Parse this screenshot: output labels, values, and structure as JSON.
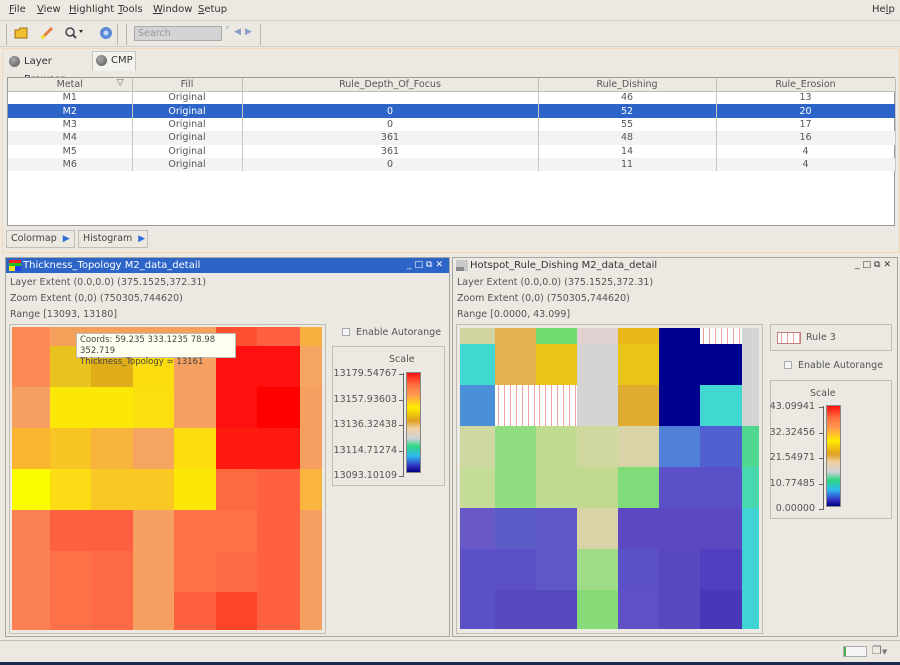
{
  "menu": {
    "items": [
      {
        "label": "File",
        "u": "F",
        "rest": "ile"
      },
      {
        "label": "View",
        "u": "V",
        "rest": "iew"
      },
      {
        "label": "Highlight",
        "u": "H",
        "rest": "ighlight"
      },
      {
        "label": "Tools",
        "u": "T",
        "rest": "ools"
      },
      {
        "label": "Window",
        "u": "W",
        "rest": "indow"
      },
      {
        "label": "Setup",
        "u": "S",
        "rest": "etup"
      }
    ],
    "help": {
      "label": "Help",
      "pre": "He",
      "u": "l",
      "rest": "p"
    }
  },
  "toolbar": {
    "search_placeholder": "Search"
  },
  "tabs": [
    {
      "label": "Layer Browser",
      "active": false
    },
    {
      "label": "CMP",
      "active": true
    }
  ],
  "table": {
    "columns": [
      "Metal",
      "Fill",
      "Rule_Depth_Of_Focus",
      "Rule_Dishing",
      "Rule_Erosion"
    ],
    "rows": [
      {
        "metal": "M1",
        "fill": "Original",
        "dof": "",
        "dishing": "46",
        "erosion": "13"
      },
      {
        "metal": "M2",
        "fill": "Original",
        "dof": "0",
        "dishing": "52",
        "erosion": "20",
        "selected": true
      },
      {
        "metal": "M3",
        "fill": "Original",
        "dof": "0",
        "dishing": "55",
        "erosion": "17"
      },
      {
        "metal": "M4",
        "fill": "Original",
        "dof": "361",
        "dishing": "48",
        "erosion": "16"
      },
      {
        "metal": "M5",
        "fill": "Original",
        "dof": "361",
        "dishing": "14",
        "erosion": "4"
      },
      {
        "metal": "M6",
        "fill": "Original",
        "dof": "0",
        "dishing": "11",
        "erosion": "4"
      }
    ]
  },
  "bottom_buttons": {
    "colormap": "Colormap",
    "histogram": "Histogram"
  },
  "left_view": {
    "title": "Thickness_Topology M2_data_detail",
    "layer_extent": "Layer Extent (0.0,0.0) (375.1525,372.31)",
    "zoom_extent": "Zoom Extent (0,0) (750305,744620)",
    "range": "Range [13093, 13180]",
    "tooltip_line1": "Coords: 59.235 333.1235 78.98 352.719",
    "tooltip_line2": "Thickness_Topology = 13161",
    "autorange_label": "Enable Autorange",
    "scale_title": "Scale",
    "scale_ticks": [
      "13179.54767",
      "13157.93603",
      "13136.32438",
      "13114.71274",
      "13093.10109"
    ],
    "grid": [
      [
        "#fb8a55",
        "#f5a05a",
        "#f5a05a",
        "#f5a05a",
        "#f5a05a",
        "#fd5030",
        "#fe6040",
        "#f9b040"
      ],
      [
        "#fb8a55",
        "#e8c21e",
        "#e0ad1a",
        "#fbdc0f",
        "#f5a060",
        "#fe1010",
        "#fe1010",
        "#f5a560"
      ],
      [
        "#f5a060",
        "#fbe808",
        "#fbe808",
        "#fbe010",
        "#f5a060",
        "#fe1010",
        "#fe0000",
        "#f5a060"
      ],
      [
        "#f9b530",
        "#f9c525",
        "#f7b540",
        "#f5a560",
        "#fbdc0f",
        "#fe1a10",
        "#fe1a10",
        "#f5a060"
      ],
      [
        "#fcfc00",
        "#fbdc15",
        "#f9c825",
        "#f9c825",
        "#fbe808",
        "#fe6a40",
        "#fe6040",
        "#f9b540"
      ],
      [
        "#fb8055",
        "#fd6040",
        "#fd6040",
        "#f5a060",
        "#fe7048",
        "#fe7048",
        "#fe6040",
        "#f5a060"
      ],
      [
        "#fb8055",
        "#fd7048",
        "#fd6a45",
        "#f5a060",
        "#fe7048",
        "#fe6a45",
        "#fe6040",
        "#f5a060"
      ],
      [
        "#fb8055",
        "#fd7048",
        "#fd6a45",
        "#f5a060",
        "#fe6040",
        "#fe4528",
        "#fe6040",
        "#f5a060"
      ]
    ]
  },
  "right_view": {
    "title": "Hotspot_Rule_Dishing M2_data_detail",
    "layer_extent": "Layer Extent (0.0,0.0) (375.1525,372.31)",
    "zoom_extent": "Zoom Extent (0,0) (750305,744620)",
    "range": "Range [0.0000, 43.099]",
    "legend_rule": "Rule 3",
    "autorange_label": "Enable Autorange",
    "scale_title": "Scale",
    "scale_ticks": [
      "43.09941",
      "32.32456",
      "21.54971",
      "10.77485",
      "0.00000"
    ],
    "grid": [
      [
        "#cfd4a0",
        "#e5b050",
        "#70dc70",
        "#e0d0d0",
        "#e8b818",
        "#000090",
        "pattern",
        "#d4d4d4"
      ],
      [
        "#40d8d0",
        "#e5b050",
        "#ebc418",
        "#d4d4d4",
        "#ebc418",
        "#000090",
        "#000090",
        "#d4d4d4"
      ],
      [
        "#4a90d8",
        "pattern",
        "pattern",
        "#d4d4d4",
        "#e0ac30",
        "#000090",
        "#40d8d0",
        "#d4d4d4"
      ],
      [
        "#cfd8a0",
        "#90dc80",
        "#c0dc90",
        "#d0d8a0",
        "#d8d4a8",
        "#5080d8",
        "#5060d0",
        "#50d890"
      ],
      [
        "#c4dc98",
        "#90dc80",
        "#c0dc90",
        "#c0d890",
        "#80dc78",
        "#5c50c8",
        "#5c50c8",
        "#48d8b0"
      ],
      [
        "#6858c8",
        "#5c5cc8",
        "#6058c8",
        "#d8d4a8",
        "#5c48c0",
        "#5c48c0",
        "#5c48c0",
        "#40d4d4"
      ],
      [
        "#5c50c8",
        "#5c50c8",
        "#6058c8",
        "#a0dc88",
        "#5c50c8",
        "#5848c0",
        "#5040c0",
        "#40d4d4"
      ],
      [
        "#5c50c8",
        "#5848c0",
        "#5848c0",
        "#88dc78",
        "#6050c8",
        "#5848c0",
        "#4838b8",
        "#40d4d4"
      ]
    ]
  },
  "colors": {
    "selection": "#2d64c8",
    "active_title": "#2d64c8"
  }
}
